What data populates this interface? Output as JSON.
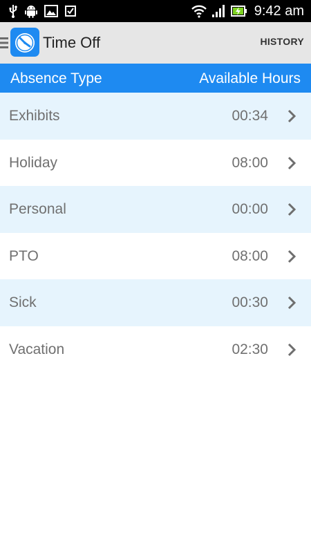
{
  "status_bar": {
    "time": "9:42 am"
  },
  "action_bar": {
    "title": "Time Off",
    "history_label": "HISTORY"
  },
  "table": {
    "col_type": "Absence Type",
    "col_hours": "Available Hours",
    "rows": [
      {
        "name": "Exhibits",
        "hours": "00:34"
      },
      {
        "name": "Holiday",
        "hours": "08:00"
      },
      {
        "name": "Personal",
        "hours": "00:00"
      },
      {
        "name": "PTO",
        "hours": "08:00"
      },
      {
        "name": "Sick",
        "hours": "00:30"
      },
      {
        "name": "Vacation",
        "hours": "02:30"
      }
    ]
  },
  "icons": [
    "usb-icon",
    "android-icon",
    "image-icon",
    "checkbox-icon",
    "wifi-icon",
    "signal-icon",
    "battery-icon",
    "drawer-icon",
    "clock-logo-icon",
    "chevron-right-icon"
  ],
  "colors": {
    "status_bar": "#000000",
    "action_bar": "#e6e6e6",
    "header_accent": "#1e8af1",
    "row_alt": "#e6f4fd",
    "row_plain": "#ffffff",
    "row_text": "#707070"
  }
}
